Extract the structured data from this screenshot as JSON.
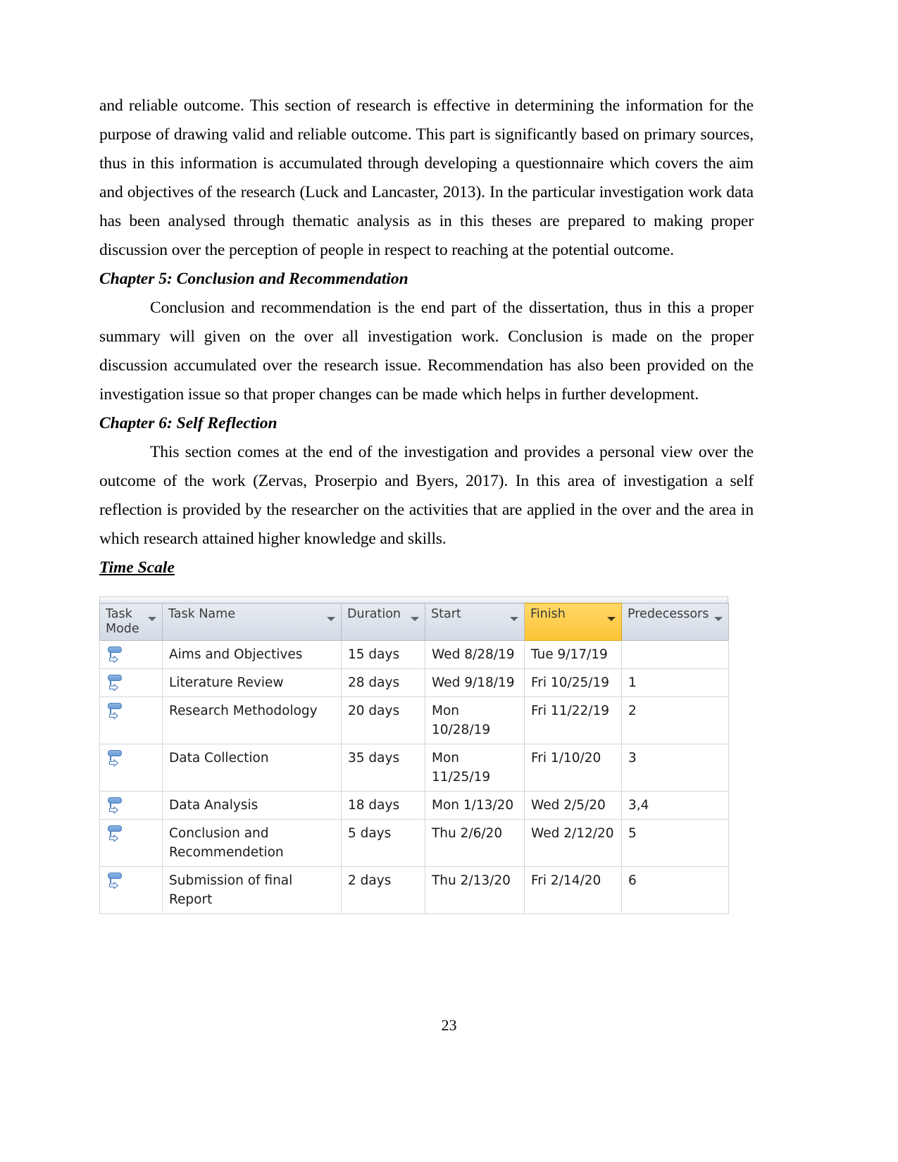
{
  "document": {
    "page_number": "23",
    "paragraphs": [
      {
        "id": "para_methodology_continuation",
        "text": "and reliable outcome. This section of research is effective in determining the information for the purpose of drawing valid and reliable outcome. This part is significantly based on primary sources, thus in this information is accumulated through developing a questionnaire which covers the aim and objectives of the research (Luck and Lancaster, 2013). In the particular investigation work data has been analysed through thematic analysis as in this theses are prepared to making proper discussion over  the perception of people in respect to reaching at the potential outcome."
      },
      {
        "id": "para_chapter5_body",
        "text": "Conclusion and recommendation is the end part of the dissertation, thus in this a proper summary will given on the over all investigation work. Conclusion is made on the proper discussion accumulated over the research issue. Recommendation has also been provided on the investigation issue so that proper changes can be made which helps in further development."
      },
      {
        "id": "para_chapter6_body",
        "text": "This section comes at the end of the investigation and provides a personal view over the outcome of the work (Zervas, Proserpio and Byers, 2017). In this area of investigation a self reflection is provided by the researcher on the activities that are applied in the over and the area in which research attained higher knowledge and skills."
      }
    ],
    "headings": {
      "chapter5": "Chapter 5: Conclusion and Recommendation",
      "chapter6": "Chapter 6: Self Reflection",
      "time_scale": "Time Scale "
    }
  },
  "project_table": {
    "accent_header_color": "#ffcd4d",
    "header_color": "#dde3eb",
    "columns": [
      {
        "key": "task_mode",
        "label": "Task Mode",
        "has_filter": true,
        "highlighted": false
      },
      {
        "key": "task_name",
        "label": "Task Name",
        "has_filter": true,
        "highlighted": false
      },
      {
        "key": "duration",
        "label": "Duration",
        "has_filter": true,
        "highlighted": false
      },
      {
        "key": "start",
        "label": "Start",
        "has_filter": true,
        "highlighted": false
      },
      {
        "key": "finish",
        "label": "Finish",
        "has_filter": true,
        "highlighted": true
      },
      {
        "key": "predecessors",
        "label": "Predecessors",
        "has_filter": true,
        "highlighted": false
      }
    ],
    "rows": [
      {
        "mode_icon": "auto-schedule-icon",
        "task_name": "Aims and Objectives",
        "duration": "15 days",
        "start": "Wed 8/28/19",
        "finish": "Tue 9/17/19",
        "predecessors": ""
      },
      {
        "mode_icon": "auto-schedule-icon",
        "task_name": "Literature Review",
        "duration": "28 days",
        "start": "Wed 9/18/19",
        "finish": "Fri 10/25/19",
        "predecessors": "1"
      },
      {
        "mode_icon": "auto-schedule-icon",
        "task_name": "Research Methodology",
        "duration": "20 days",
        "start": "Mon 10/28/19",
        "finish": "Fri 11/22/19",
        "predecessors": "2"
      },
      {
        "mode_icon": "auto-schedule-icon",
        "task_name": "Data Collection",
        "duration": "35 days",
        "start": "Mon 11/25/19",
        "finish": "Fri 1/10/20",
        "predecessors": "3"
      },
      {
        "mode_icon": "auto-schedule-icon",
        "task_name": "Data Analysis",
        "duration": "18 days",
        "start": "Mon 1/13/20",
        "finish": "Wed 2/5/20",
        "predecessors": "3,4"
      },
      {
        "mode_icon": "auto-schedule-icon",
        "task_name": "Conclusion and Recommendetion",
        "duration": "5 days",
        "start": "Thu 2/6/20",
        "finish": "Wed 2/12/20",
        "predecessors": "5"
      },
      {
        "mode_icon": "auto-schedule-icon",
        "task_name": "Submission of final Report",
        "duration": "2 days",
        "start": "Thu 2/13/20",
        "finish": "Fri 2/14/20",
        "predecessors": "6"
      }
    ]
  }
}
